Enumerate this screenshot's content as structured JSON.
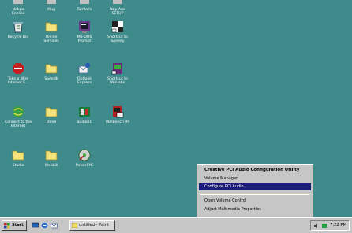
{
  "desktop": {
    "icons": [
      {
        "label": "Nakpo\nKnelios"
      },
      {
        "label": "Wug"
      },
      {
        "label": "Tamlalhi"
      },
      {
        "label": "Nap Ane\nSETUP"
      },
      {
        "label": "Recycle Bin"
      },
      {
        "label": "Online\nServices"
      },
      {
        "label": "MS-DOS\nPrompt"
      },
      {
        "label": "Shortcut to\nSpeedy"
      },
      {
        "label": "Take a Wire\nInternet E..."
      },
      {
        "label": "Speedb"
      },
      {
        "label": "Outlook\nExpress"
      },
      {
        "label": "Shortcut to\nWinlabs"
      },
      {
        "label": "Connect to the\nInternet"
      },
      {
        "label": "steve"
      },
      {
        "label": "audio01"
      },
      {
        "label": "WinBench 99"
      },
      {
        "label": "Studio"
      },
      {
        "label": "Webbill"
      },
      {
        "label": "PowerFYC"
      }
    ]
  },
  "context_menu": {
    "title": "Creative PCI Audio Configuration Utility",
    "item_volume_manager": "Volume Manager",
    "item_configure": "Configure PCI Audio",
    "item_open_volume": "Open Volume Control",
    "item_adjust": "Adjust Multimedia Properties"
  },
  "taskbar": {
    "start_label": "Start",
    "window_button_label": "untitled - Paint",
    "clock": "7:22 PM"
  }
}
